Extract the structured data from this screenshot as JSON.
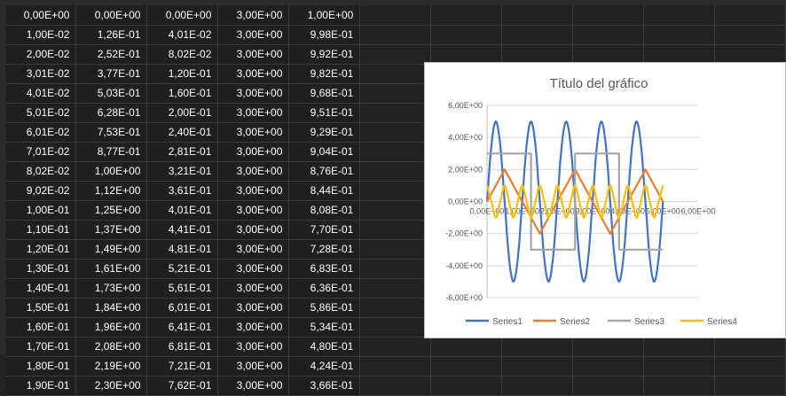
{
  "sheet": {
    "rows": [
      [
        "0,00E+00",
        "0,00E+00",
        "0,00E+00",
        "3,00E+00",
        "1,00E+00"
      ],
      [
        "1,00E-02",
        "1,26E-01",
        "4,01E-02",
        "3,00E+00",
        "9,98E-01"
      ],
      [
        "2,00E-02",
        "2,52E-01",
        "8,02E-02",
        "3,00E+00",
        "9,92E-01"
      ],
      [
        "3,01E-02",
        "3,77E-01",
        "1,20E-01",
        "3,00E+00",
        "9,82E-01"
      ],
      [
        "4,01E-02",
        "5,03E-01",
        "1,60E-01",
        "3,00E+00",
        "9,68E-01"
      ],
      [
        "5,01E-02",
        "6,28E-01",
        "2,00E-01",
        "3,00E+00",
        "9,51E-01"
      ],
      [
        "6,01E-02",
        "7,53E-01",
        "2,40E-01",
        "3,00E+00",
        "9,29E-01"
      ],
      [
        "7,01E-02",
        "8,77E-01",
        "2,81E-01",
        "3,00E+00",
        "9,04E-01"
      ],
      [
        "8,02E-02",
        "1,00E+00",
        "3,21E-01",
        "3,00E+00",
        "8,76E-01"
      ],
      [
        "9,02E-02",
        "1,12E+00",
        "3,61E-01",
        "3,00E+00",
        "8,44E-01"
      ],
      [
        "1,00E-01",
        "1,25E+00",
        "4,01E-01",
        "3,00E+00",
        "8,08E-01"
      ],
      [
        "1,10E-01",
        "1,37E+00",
        "4,41E-01",
        "3,00E+00",
        "7,70E-01"
      ],
      [
        "1,20E-01",
        "1,49E+00",
        "4,81E-01",
        "3,00E+00",
        "7,28E-01"
      ],
      [
        "1,30E-01",
        "1,61E+00",
        "5,21E-01",
        "3,00E+00",
        "6,83E-01"
      ],
      [
        "1,40E-01",
        "1,73E+00",
        "5,61E-01",
        "3,00E+00",
        "6,36E-01"
      ],
      [
        "1,50E-01",
        "1,84E+00",
        "6,01E-01",
        "3,00E+00",
        "5,86E-01"
      ],
      [
        "1,60E-01",
        "1,96E+00",
        "6,41E-01",
        "3,00E+00",
        "5,34E-01"
      ],
      [
        "1,70E-01",
        "2,08E+00",
        "6,81E-01",
        "3,00E+00",
        "4,80E-01"
      ],
      [
        "1,80E-01",
        "2,19E+00",
        "7,21E-01",
        "3,00E+00",
        "4,24E-01"
      ],
      [
        "1,90E-01",
        "2,30E+00",
        "7,62E-01",
        "3,00E+00",
        "3,66E-01"
      ]
    ],
    "empty_columns": 6
  },
  "chart_data": {
    "type": "line",
    "title": "Título del gráfico",
    "xlabel": "",
    "ylabel": "",
    "xlim": [
      0,
      6
    ],
    "ylim": [
      -6,
      6
    ],
    "x_ticks": [
      "0,00E+00",
      "1,00E+00",
      "2,00E+00",
      "3,00E+00",
      "4,00E+00",
      "5,00E+00",
      "6,00E+00"
    ],
    "y_ticks": [
      "6,00E+00",
      "4,00E+00",
      "2,00E+00",
      "0,00E+00",
      "-2,00E+00",
      "-4,00E+00",
      "-6,00E+00"
    ],
    "y_tick_values": [
      6,
      4,
      2,
      0,
      -2,
      -4,
      -6
    ],
    "x_tick_values": [
      0,
      1,
      2,
      3,
      4,
      5,
      6
    ],
    "grid": true,
    "legend_position": "bottom",
    "series": [
      {
        "name": "Series1",
        "color": "#4472c4",
        "x": [
          0,
          0.125,
          0.25,
          0.375,
          0.5,
          0.625,
          0.75,
          0.875,
          1,
          1.125,
          1.25,
          1.375,
          1.5,
          1.625,
          1.75,
          1.875,
          2,
          2.125,
          2.25,
          2.375,
          2.5,
          2.625,
          2.75,
          2.875,
          3,
          3.125,
          3.25,
          3.375,
          3.5,
          3.625,
          3.75,
          3.875,
          4,
          4.125,
          4.25,
          4.375,
          4.5,
          4.625,
          4.75,
          4.875,
          5
        ],
        "y": [
          0,
          3.54,
          5,
          3.54,
          0,
          -3.54,
          -5,
          -3.54,
          0,
          3.54,
          5,
          3.54,
          0,
          -3.54,
          -5,
          -3.54,
          0,
          3.54,
          5,
          3.54,
          0,
          -3.54,
          -5,
          -3.54,
          0,
          3.54,
          5,
          3.54,
          0,
          -3.54,
          -5,
          -3.54,
          0,
          3.54,
          5,
          3.54,
          0,
          -3.54,
          -5,
          -3.54,
          0
        ]
      },
      {
        "name": "Series2",
        "color": "#ed7d31",
        "x": [
          0,
          0.5,
          1,
          1.5,
          2,
          2.5,
          3,
          3.5,
          4,
          4.5,
          5
        ],
        "y": [
          0,
          2,
          0,
          -2,
          0,
          2,
          0,
          -2,
          0,
          2,
          0
        ]
      },
      {
        "name": "Series3",
        "color": "#a5a5a5",
        "x": [
          0,
          1.25,
          1.25,
          2.5,
          2.5,
          3.75,
          3.75,
          5
        ],
        "y": [
          3,
          3,
          -3,
          -3,
          3,
          3,
          -3,
          -3
        ]
      },
      {
        "name": "Series4",
        "color": "#ffc000",
        "x": [
          0,
          0.125,
          0.25,
          0.375,
          0.5,
          0.625,
          0.75,
          0.875,
          1,
          1.125,
          1.25,
          1.375,
          1.5,
          1.625,
          1.75,
          1.875,
          2,
          2.125,
          2.25,
          2.375,
          2.5,
          2.625,
          2.75,
          2.875,
          3,
          3.125,
          3.25,
          3.375,
          3.5,
          3.625,
          3.75,
          3.875,
          4,
          4.125,
          4.25,
          4.375,
          4.5,
          4.625,
          4.75,
          4.875,
          5
        ],
        "y": [
          1,
          0,
          -1,
          0,
          1,
          0,
          -1,
          0,
          1,
          0,
          -1,
          0,
          1,
          0,
          -1,
          0,
          1,
          0,
          -1,
          0,
          1,
          0,
          -1,
          0,
          1,
          0,
          -1,
          0,
          1,
          0,
          -1,
          0,
          1,
          0,
          -1,
          0,
          1,
          0,
          -1,
          0,
          1
        ]
      }
    ]
  },
  "colors": {
    "sheet_background": "#1f1f1f",
    "grid_line": "#3a3a3a",
    "cell_text": "#ffffff"
  }
}
